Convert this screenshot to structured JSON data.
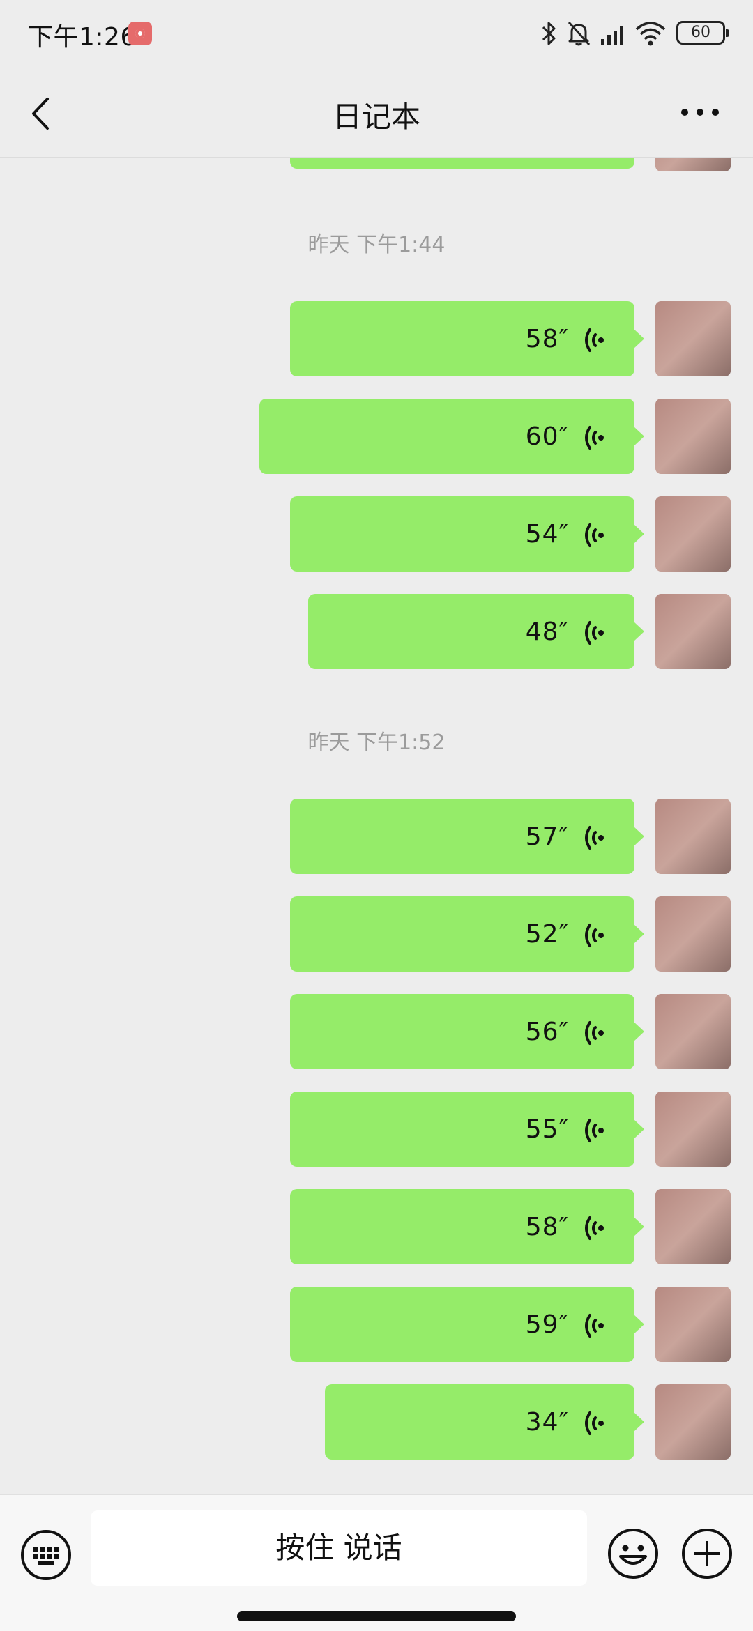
{
  "status_bar": {
    "time": "下午1:26",
    "battery": "60",
    "icons": [
      "record-icon",
      "bluetooth-icon",
      "mute-icon",
      "signal-icon",
      "wifi-icon",
      "battery-icon"
    ]
  },
  "nav": {
    "title": "日记本",
    "back_icon": "chevron-left-icon",
    "more_icon": "more-dots-icon"
  },
  "chat": {
    "dividers": [
      "昨天 下午1:44",
      "昨天 下午1:52"
    ],
    "messages": [
      {
        "duration": "58″"
      },
      {
        "duration": "60″"
      },
      {
        "duration": "54″"
      },
      {
        "duration": "48″"
      },
      {
        "duration": "57″"
      },
      {
        "duration": "52″"
      },
      {
        "duration": "56″"
      },
      {
        "duration": "55″"
      },
      {
        "duration": "58″"
      },
      {
        "duration": "59″"
      },
      {
        "duration": "34″"
      }
    ]
  },
  "input_bar": {
    "hold_to_talk": "按住 说话",
    "left_icon": "keyboard-icon",
    "right_icons": [
      "emoji-icon",
      "plus-icon"
    ]
  },
  "colors": {
    "background": "#ededed",
    "bubble": "#95ec69",
    "timestamp": "#9b9b9b"
  }
}
